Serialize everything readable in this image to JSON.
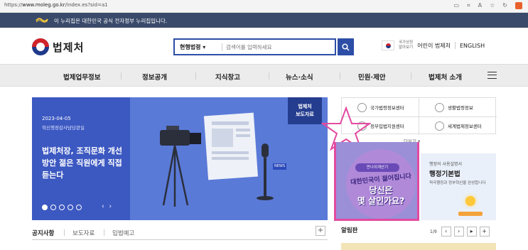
{
  "browser": {
    "url_prefix": "https://",
    "url_host": "www.moleg.go.kr",
    "url_path": "/index.es?sid=a1",
    "ext_icon": "ublock-icon"
  },
  "gov_banner": {
    "text": "이 누리집은 대한민국 공식 전자정부 누리집입니다."
  },
  "header": {
    "logo_text": "법제처",
    "search_scope": "현행법령",
    "search_placeholder": "검색어를 입력하세요",
    "small_line1": "국가상징",
    "small_line2": "알아보기",
    "kids_link": "어린이 법제처",
    "english_link": "ENGLISH"
  },
  "nav": {
    "items": [
      "법제업무정보",
      "정보공개",
      "지식창고",
      "뉴스·소식",
      "민원·제안",
      "법제처 소개"
    ]
  },
  "hero": {
    "date": "2023-04-05",
    "dept": "혁신행정감사담당관실",
    "title": "법제처장, 조직문화 개선 방안 젊은 직원에게 직접 듣는다",
    "badge_line1": "법제처",
    "badge_line2": "보도자료",
    "news_label": "NEWS",
    "controls": "‹ ›"
  },
  "quick": {
    "items": [
      "국가법령정보센터",
      "생활법령정보",
      "정부입법지원센터",
      "세계법제정보센터"
    ],
    "more": "더보기"
  },
  "promo1": {
    "tag": "만나이계산기",
    "line1": "대한민국이 젊어집니다",
    "line2a": "당신은",
    "line2b": "몇 살인가요?"
  },
  "promo2": {
    "a": "행정의 사용설명서",
    "b": "행정기본법",
    "c": "적극행정과 정부혁신을 완성합니다"
  },
  "notice": {
    "tabs": [
      "공지사항",
      "보도자료",
      "입법예고"
    ],
    "plus": "+"
  },
  "board": {
    "title": "알림판",
    "page": "1/9"
  },
  "colors": {
    "navy": "#3a4a6b",
    "brand_blue": "#2d4ea6",
    "hero_blue": "#5a7ad8",
    "highlight": "#e24aa0"
  }
}
